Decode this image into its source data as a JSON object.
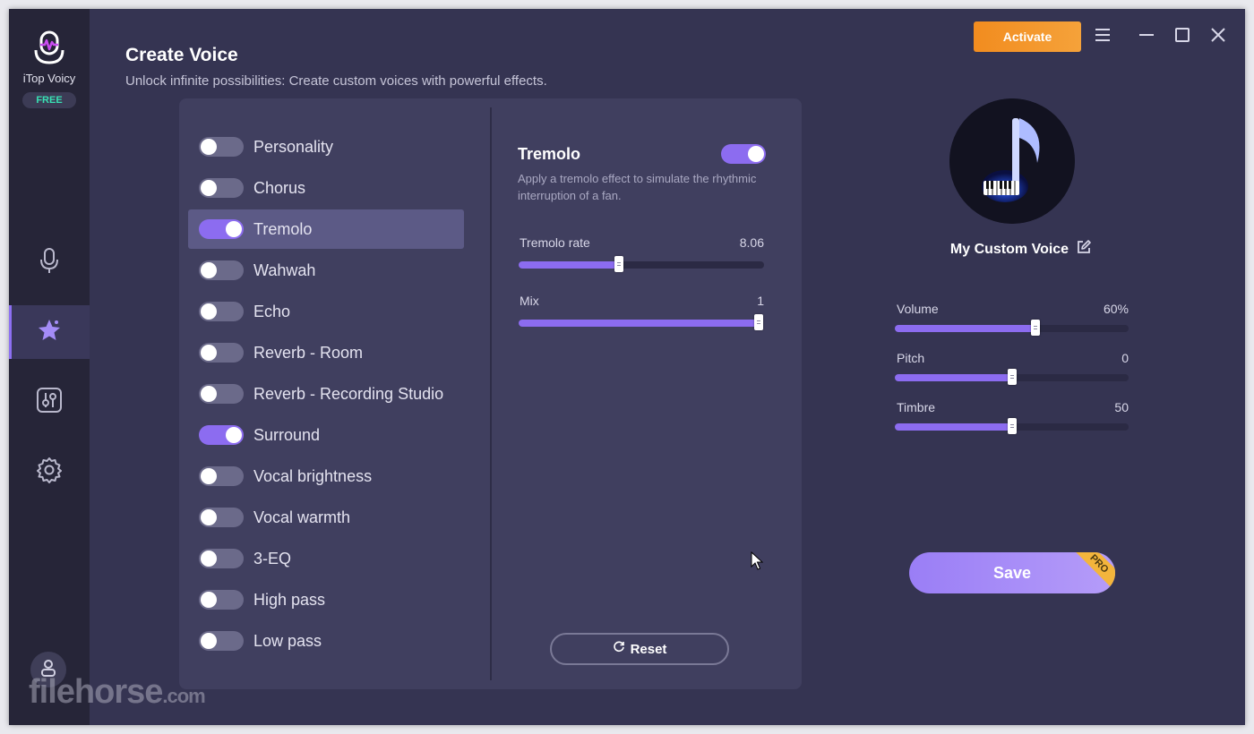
{
  "app": {
    "name": "iTop Voicy",
    "badge": "FREE",
    "activate_label": "Activate"
  },
  "header": {
    "title": "Create Voice",
    "subtitle": "Unlock infinite possibilities: Create custom voices with powerful effects."
  },
  "sidebar": {
    "items": [
      {
        "icon": "microphone-icon",
        "active": false
      },
      {
        "icon": "sparkle-star-icon",
        "active": true
      },
      {
        "icon": "equalizer-icon",
        "active": false
      },
      {
        "icon": "gear-icon",
        "active": false
      }
    ]
  },
  "effects": [
    {
      "label": "Personality",
      "on": false
    },
    {
      "label": "Chorus",
      "on": false
    },
    {
      "label": "Tremolo",
      "on": true,
      "selected": true
    },
    {
      "label": "Wahwah",
      "on": false
    },
    {
      "label": "Echo",
      "on": false
    },
    {
      "label": "Reverb - Room",
      "on": false
    },
    {
      "label": "Reverb - Recording Studio",
      "on": false
    },
    {
      "label": "Surround",
      "on": true
    },
    {
      "label": "Vocal brightness",
      "on": false
    },
    {
      "label": "Vocal warmth",
      "on": false
    },
    {
      "label": "3-EQ",
      "on": false
    },
    {
      "label": "High pass",
      "on": false
    },
    {
      "label": "Low pass",
      "on": false
    }
  ],
  "detail": {
    "title": "Tremolo",
    "enabled": true,
    "description": "Apply a tremolo effect to simulate the rhythmic interruption of a fan.",
    "sliders": [
      {
        "label": "Tremolo rate",
        "value": "8.06",
        "fraction": 0.41
      },
      {
        "label": "Mix",
        "value": "1",
        "fraction": 1.0
      }
    ],
    "reset_label": "Reset"
  },
  "voice": {
    "name": "My Custom Voice",
    "sliders": [
      {
        "label": "Volume",
        "value": "60%",
        "fraction": 0.6
      },
      {
        "label": "Pitch",
        "value": "0",
        "fraction": 0.5
      },
      {
        "label": "Timbre",
        "value": "50",
        "fraction": 0.5
      }
    ],
    "save_label": "Save",
    "pro_badge": "PRO"
  },
  "watermark": {
    "text": "filehorse",
    "suffix": ".com"
  },
  "colors": {
    "accent": "#8c6cf0",
    "activate": "#f28c1f",
    "badge_text": "#39e0b4",
    "background": "#353452",
    "panel": "#403f5f"
  }
}
